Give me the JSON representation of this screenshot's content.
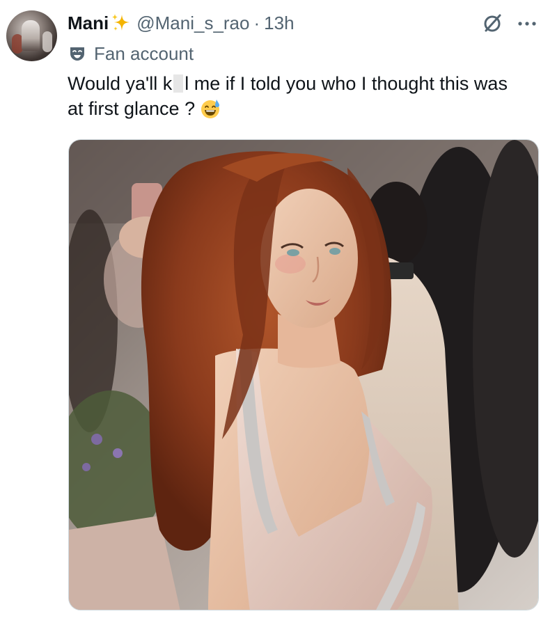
{
  "user": {
    "display_name": "Mani",
    "handle": "@Mani_s_rao",
    "separator": "·",
    "time": "13h",
    "label": "Fan account"
  },
  "tweet": {
    "line1_before": "Would ya'll k",
    "line1_after": "l me if I told you who I thought this was",
    "line2": "at first glance ?"
  },
  "icons": {
    "name_badge": "sparkles-icon",
    "label_icon": "mask-icon",
    "emoji": "sweat-smile-emoji",
    "grok": "grok-icon",
    "more": "more-options-icon"
  },
  "colors": {
    "text": "#0f1419",
    "secondary": "#536471",
    "sparkle": "#f4b400",
    "border": "#cfd9de"
  },
  "media": {
    "description_role": "photo",
    "palette": {
      "hair": "#8a3a1c",
      "skin": "#e9c1a6",
      "dress": "#e8cdc3",
      "background": "#8c837e"
    }
  }
}
